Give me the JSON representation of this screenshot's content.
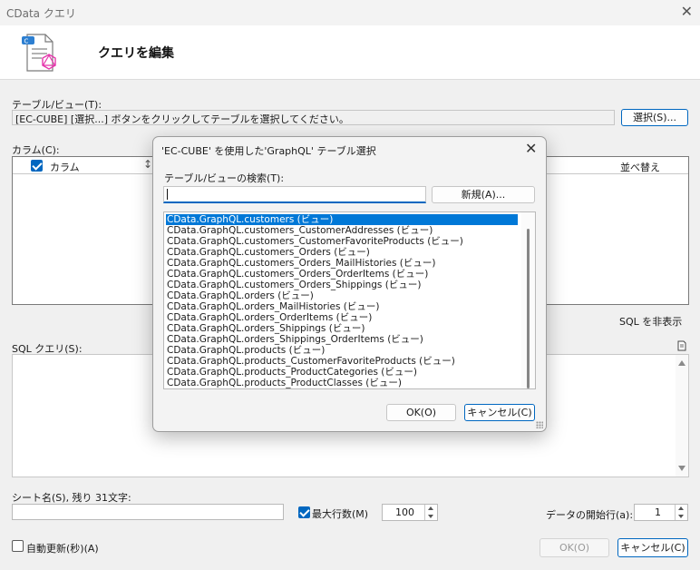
{
  "window": {
    "title": "CData クエリ"
  },
  "header": {
    "title": "クエリを編集"
  },
  "table_view": {
    "label": "テーブル/ビュー(T):",
    "value": "[EC-CUBE] [選択...] ボタンをクリックしてテーブルを選択してください。",
    "select_button": "選択(S)..."
  },
  "columns": {
    "label": "カラム(C):",
    "column_header": "カラム",
    "sort_header": "並べ替え"
  },
  "sql": {
    "toggle_label": "SQL を非表示",
    "label": "SQL クエリ(S):"
  },
  "sheet": {
    "label": "シート名(S), 残り 31文字:",
    "value": ""
  },
  "max_rows": {
    "label": "最大行数(M)",
    "checked": true,
    "value": "100"
  },
  "start_row": {
    "label": "データの開始行(a):",
    "value": "1"
  },
  "auto_refresh": {
    "label": "自動更新(秒)(A)",
    "checked": false
  },
  "footer": {
    "ok": "OK(O)",
    "cancel": "キャンセル(C)"
  },
  "modal": {
    "title": "'EC-CUBE' を使用した'GraphQL' テーブル選択",
    "search_label": "テーブル/ビューの検索(T):",
    "search_value": "",
    "new_button": "新規(A)...",
    "items": [
      "CData.GraphQL.customers (ビュー)",
      "CData.GraphQL.customers_CustomerAddresses (ビュー)",
      "CData.GraphQL.customers_CustomerFavoriteProducts (ビュー)",
      "CData.GraphQL.customers_Orders (ビュー)",
      "CData.GraphQL.customers_Orders_MailHistories (ビュー)",
      "CData.GraphQL.customers_Orders_OrderItems (ビュー)",
      "CData.GraphQL.customers_Orders_Shippings (ビュー)",
      "CData.GraphQL.orders (ビュー)",
      "CData.GraphQL.orders_MailHistories (ビュー)",
      "CData.GraphQL.orders_OrderItems (ビュー)",
      "CData.GraphQL.orders_Shippings (ビュー)",
      "CData.GraphQL.orders_Shippings_OrderItems (ビュー)",
      "CData.GraphQL.products (ビュー)",
      "CData.GraphQL.products_CustomerFavoriteProducts (ビュー)",
      "CData.GraphQL.products_ProductCategories (ビュー)",
      "CData.GraphQL.products_ProductClasses (ビュー)"
    ],
    "selected_index": 0,
    "ok": "OK(O)",
    "cancel": "キャンセル(C)"
  },
  "colors": {
    "accent": "#0067c0",
    "selection": "#0078d7",
    "graphql": "#e535ab"
  },
  "icons": [
    "close-icon",
    "document-graphql-icon",
    "sort-icon",
    "new-document-icon",
    "scroll-up-icon",
    "scroll-down-icon"
  ]
}
